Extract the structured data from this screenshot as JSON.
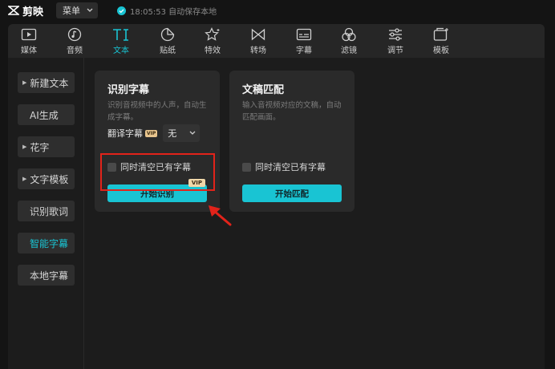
{
  "app": {
    "name": "剪映"
  },
  "titlebar": {
    "menu_label": "菜单",
    "autosave_text": "18:05:53 自动保存本地"
  },
  "toolbar": {
    "items": [
      {
        "label": "媒体",
        "icon": "media-icon"
      },
      {
        "label": "音频",
        "icon": "audio-icon"
      },
      {
        "label": "文本",
        "icon": "text-icon",
        "active": true
      },
      {
        "label": "贴纸",
        "icon": "sticker-icon"
      },
      {
        "label": "特效",
        "icon": "effects-icon"
      },
      {
        "label": "转场",
        "icon": "transition-icon"
      },
      {
        "label": "字幕",
        "icon": "subtitle-icon"
      },
      {
        "label": "滤镜",
        "icon": "filter-icon"
      },
      {
        "label": "调节",
        "icon": "adjust-icon"
      },
      {
        "label": "模板",
        "icon": "template-icon"
      }
    ]
  },
  "sidebar": {
    "items": [
      {
        "label": "新建文本",
        "expandable": true
      },
      {
        "label": "AI生成"
      },
      {
        "label": "花字",
        "expandable": true
      },
      {
        "label": "文字模板",
        "expandable": true
      },
      {
        "label": "识别歌词"
      },
      {
        "label": "智能字幕",
        "active": true
      },
      {
        "label": "本地字幕"
      }
    ]
  },
  "cards": {
    "recognize": {
      "title": "识别字幕",
      "description": "识别音视频中的人声，自动生成字幕。",
      "translate_label": "翻译字幕",
      "translate_vip": "VIP",
      "translate_value": "无",
      "clear_label": "同时清空已有字幕",
      "button_label": "开始识别",
      "button_badge": "VIP"
    },
    "match": {
      "title": "文稿匹配",
      "description": "输入音视频对应的文稿，自动匹配画面。",
      "clear_label": "同时清空已有字幕",
      "button_label": "开始匹配"
    }
  },
  "colors": {
    "accent": "#19c4d3",
    "highlight": "#e2231a",
    "vip": "#f0d7a8"
  }
}
